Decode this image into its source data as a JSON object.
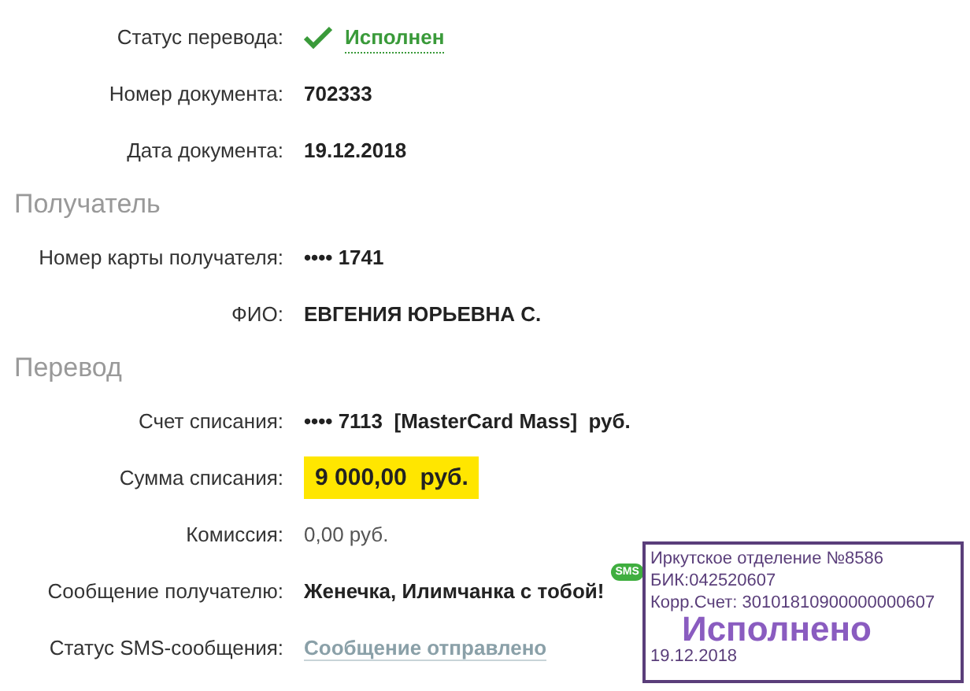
{
  "sections": [
    {
      "rows": [
        {
          "kind": "status",
          "label": "Статус перевода:",
          "value": "Исполнен"
        },
        {
          "kind": "bold",
          "label": "Номер документа:",
          "value": "702333"
        },
        {
          "kind": "bold",
          "label": "Дата документа:",
          "value": "19.12.2018"
        }
      ]
    },
    {
      "title": "Получатель",
      "rows": [
        {
          "kind": "bold",
          "label": "Номер карты получателя:",
          "value": "•••• 1741"
        },
        {
          "kind": "bold",
          "label": "ФИО:",
          "value": "ЕВГЕНИЯ ЮРЬЕВНА С."
        }
      ]
    },
    {
      "title": "Перевод",
      "rows": [
        {
          "kind": "bold",
          "label": "Счет списания:",
          "value": "•••• 7113  [MasterCard Mass]  руб."
        },
        {
          "kind": "highlight",
          "label": "Сумма списания:",
          "value": "9 000,00  руб."
        },
        {
          "kind": "plain",
          "label": "Комиссия:",
          "value": "0,00 руб."
        },
        {
          "kind": "message",
          "label": "Сообщение получателю:",
          "value": "Женечка, Илимчанка с тобой!",
          "badge": "SMS"
        },
        {
          "kind": "link",
          "label": "Статус SMS-сообщения:",
          "value": "Сообщение отправлено"
        }
      ]
    }
  ],
  "stamp": {
    "lines": [
      "Иркутское отделение №8586",
      "БИК:042520607",
      "Корр.Счет: 30101810900000000607"
    ],
    "status": "Исполнено",
    "date": "19.12.2018"
  }
}
